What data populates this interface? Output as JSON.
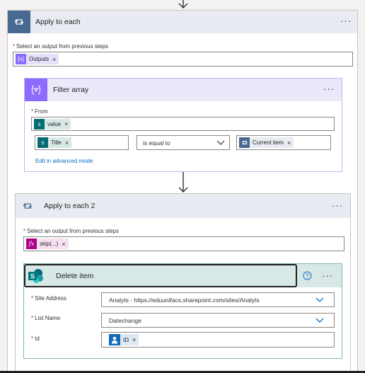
{
  "apply_each": {
    "title": "Apply to each",
    "output_label": "Select an output from previous steps",
    "token": "Outputs"
  },
  "filter": {
    "title": "Filter array",
    "from_label": "From",
    "from_token": "value",
    "condition_left_token": "Title",
    "operator": "is equal to",
    "condition_right_token": "Current item",
    "advanced_link": "Edit in advanced mode"
  },
  "apply_each_2": {
    "title": "Apply to each 2",
    "output_label": "Select an output from previous steps",
    "token": "skip(...)"
  },
  "delete_item": {
    "title": "Delete item",
    "site_label": "Site Address",
    "site_value": "Analyts - https://eduunifacs.sharepoint.com/sites/Analyts",
    "list_label": "List Name",
    "list_value": "Datechange",
    "id_label": "Id",
    "id_token": "ID"
  },
  "icons": {
    "loop": "loop-icon",
    "filter": "filter-icon",
    "sharepoint": "sharepoint-icon",
    "expression": "fx-icon",
    "variable": "variable-icon",
    "person": "person-icon",
    "help": "help-icon",
    "more": "more-dots-icon"
  },
  "colors": {
    "loop_header": "#e8ebf2",
    "loop_icon": "#486991",
    "filter_header": "#ede7fa",
    "filter_icon": "#8c6cff",
    "sharepoint_header": "#d7e8e7",
    "sharepoint_icon": "#036c70",
    "expression_token": "#ad008c",
    "variable_token": "#6c4ee0",
    "link": "#0f6cbd"
  }
}
